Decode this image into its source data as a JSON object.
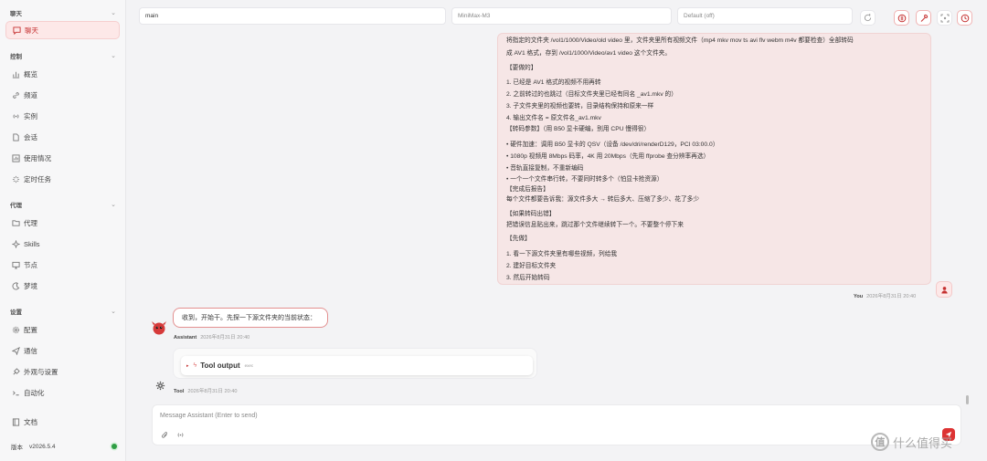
{
  "sidebar": {
    "sections": [
      {
        "label": "聊天"
      },
      {
        "label": "控制"
      },
      {
        "label": "代理"
      },
      {
        "label": "设置"
      }
    ],
    "items": [
      {
        "label": "聊天",
        "icon": "chat-icon"
      },
      {
        "label": "概览",
        "icon": "chart-icon"
      },
      {
        "label": "频道",
        "icon": "link-icon"
      },
      {
        "label": "实例",
        "icon": "radio-icon"
      },
      {
        "label": "会话",
        "icon": "file-icon"
      },
      {
        "label": "使用情况",
        "icon": "bar-chart-icon"
      },
      {
        "label": "定时任务",
        "icon": "loader-icon"
      },
      {
        "label": "代理",
        "icon": "folder-icon"
      },
      {
        "label": "Skills",
        "icon": "sparkle-icon"
      },
      {
        "label": "节点",
        "icon": "monitor-icon"
      },
      {
        "label": "梦境",
        "icon": "moon-icon"
      },
      {
        "label": "配置",
        "icon": "gear-icon"
      },
      {
        "label": "通信",
        "icon": "send-icon"
      },
      {
        "label": "外观与设置",
        "icon": "palette-icon"
      },
      {
        "label": "自动化",
        "icon": "terminal-icon"
      },
      {
        "label": "文档",
        "icon": "book-icon"
      }
    ],
    "version_label": "版本",
    "version": "v2026.5.4",
    "status_color": "#2f9e44"
  },
  "topbar": {
    "session": "main",
    "model": "MiniMax-M3",
    "thinking": "Default (off)"
  },
  "user_message": {
    "lines": [
      "将指定的文件夹 /vol1/1000/Video/old video 里，文件夹里所有视频文件（mp4 mkv mov ts avi flv webm m4v 都要检查）全部转码",
      "成 AV1 格式，存到 /vol1/1000/Video/av1 video 这个文件夹。",
      "【要做的】",
      "1. 已经是 AV1 格式的视频不用再转",
      "2. 之前转过的也跳过（目标文件夹里已经有同名 _av1.mkv 的）",
      "3. 子文件夹里的视频也要转，目录结构保持和原来一样",
      "4. 输出文件名 = 原文件名_av1.mkv",
      "【转码参数】（用 B50 显卡硬编，别用 CPU 慢得很）",
      "• 硬件加速：调用 B50 显卡的 QSV（设备 /dev/dri/renderD129，PCI 03:00.0）",
      "• 1080p 视频用 8Mbps 码率，4K 用 20Mbps（先用 ffprobe 查分辨率再选）",
      "• 音轨直接复制，不重新编码",
      "• 一个一个文件串行转，不要同时转多个（怕显卡抢资源）",
      "【完成后报告】",
      "每个文件都要告诉我：源文件多大 → 转后多大、压缩了多少、花了多少",
      "【如果转码出错】",
      "把错误信息贴出来，跳过那个文件继续转下一个。不要整个停下来",
      "【先做】",
      "1. 看一下源文件夹里有哪些视频，列给我",
      "2. 建好目标文件夹",
      "3. 然后开始转码"
    ],
    "sender": "You",
    "time": "2026年8月31日 20:40"
  },
  "assistant_message": {
    "text": "收到，开始干。先探一下源文件夹的当前状态：",
    "sender": "Assistant",
    "time": "2026年8月31日 20:40"
  },
  "tool_message": {
    "title": "Tool output",
    "tag": "exec",
    "sender": "Tool",
    "time": "2026年8月31日 20:40"
  },
  "composer": {
    "placeholder": "Message Assistant (Enter to send)"
  },
  "watermark": {
    "text": "什么值得买",
    "mark": "值"
  },
  "colors": {
    "accent": "#c53030",
    "accent_bg": "#fde8e8",
    "user_bubble": "#f6e6e6"
  }
}
